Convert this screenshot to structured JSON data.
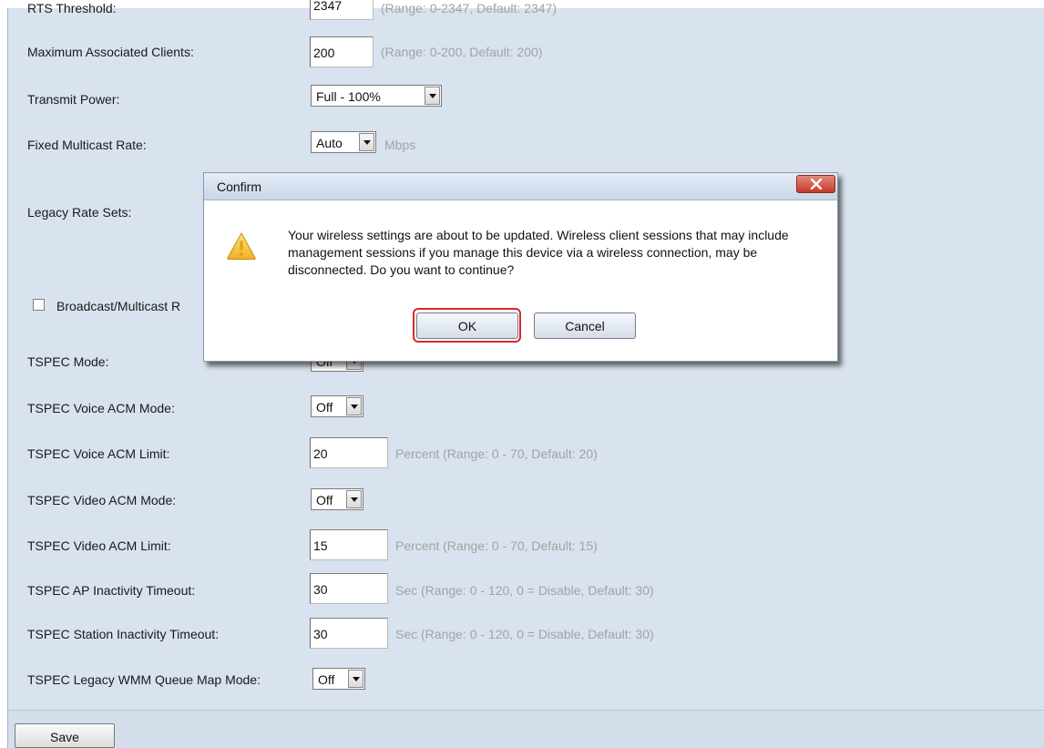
{
  "settings": {
    "rts_threshold": {
      "label": "RTS Threshold:",
      "value": "2347",
      "hint": "(Range: 0-2347, Default: 2347)"
    },
    "max_clients": {
      "label": "Maximum Associated Clients:",
      "value": "200",
      "hint": "(Range: 0-200, Default: 200)"
    },
    "transmit_power": {
      "label": "Transmit Power:",
      "value": "Full - 100%"
    },
    "fixed_multicast_rate": {
      "label": "Fixed Multicast Rate:",
      "value": "Auto",
      "unit": "Mbps"
    },
    "legacy_rate_sets": {
      "label": "Legacy Rate Sets:"
    },
    "broadcast_multicast": {
      "label": "Broadcast/Multicast R",
      "checked": false
    },
    "tspec_mode": {
      "label": "TSPEC Mode:",
      "value": "Off"
    },
    "tspec_voice_acm_mode": {
      "label": "TSPEC Voice ACM Mode:",
      "value": "Off"
    },
    "tspec_voice_acm_limit": {
      "label": "TSPEC Voice ACM Limit:",
      "value": "20",
      "hint": "Percent (Range: 0 - 70, Default: 20)"
    },
    "tspec_video_acm_mode": {
      "label": "TSPEC Video ACM Mode:",
      "value": "Off"
    },
    "tspec_video_acm_limit": {
      "label": "TSPEC Video ACM Limit:",
      "value": "15",
      "hint": "Percent (Range: 0 - 70, Default: 15)"
    },
    "tspec_ap_inactivity": {
      "label": "TSPEC AP Inactivity Timeout:",
      "value": "30",
      "hint": "Sec (Range: 0 - 120, 0 = Disable, Default: 30)"
    },
    "tspec_station_inactivity": {
      "label": "TSPEC Station Inactivity Timeout:",
      "value": "30",
      "hint": "Sec (Range: 0 - 120, 0 = Disable, Default: 30)"
    },
    "tspec_legacy_wmm": {
      "label": "TSPEC Legacy WMM Queue Map Mode:",
      "value": "Off"
    }
  },
  "footer": {
    "save_label": "Save"
  },
  "dialog": {
    "title": "Confirm",
    "message": "Your wireless settings are about to be updated. Wireless client sessions that may include management sessions if you manage this device via a wireless connection, may be disconnected. Do you want to continue?",
    "ok_label": "OK",
    "cancel_label": "Cancel",
    "icon": "warning-icon"
  },
  "colors": {
    "panel_bg": "#d9e2ef",
    "highlight_ring": "#d92a2a",
    "close_button": "#c63a27"
  }
}
